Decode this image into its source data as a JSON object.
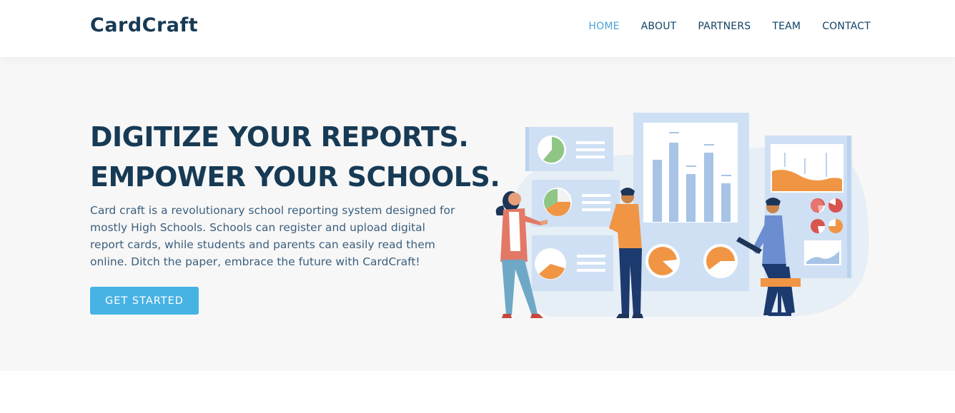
{
  "header": {
    "logo": "CardCraft",
    "nav": [
      {
        "label": "HOME",
        "active": true
      },
      {
        "label": "ABOUT",
        "active": false
      },
      {
        "label": "PARTNERS",
        "active": false
      },
      {
        "label": "TEAM",
        "active": false
      },
      {
        "label": "CONTACT",
        "active": false
      }
    ]
  },
  "hero": {
    "title_line1": "DIGITIZE YOUR REPORTS.",
    "title_line2": "EMPOWER YOUR SCHOOLS.",
    "description": "Card craft is a revolutionary school reporting system designed for mostly High Schools. Schools can register and upload digital report cards, while students and parents can easily read them online. Ditch the paper, embrace the future with CardCraft!",
    "cta_label": "GET STARTED",
    "illustration": "people-analyzing-charts-illustration"
  },
  "colors": {
    "accent": "#47b2e4",
    "heading": "#173a55",
    "hero_bg": "#f7f7f7"
  }
}
